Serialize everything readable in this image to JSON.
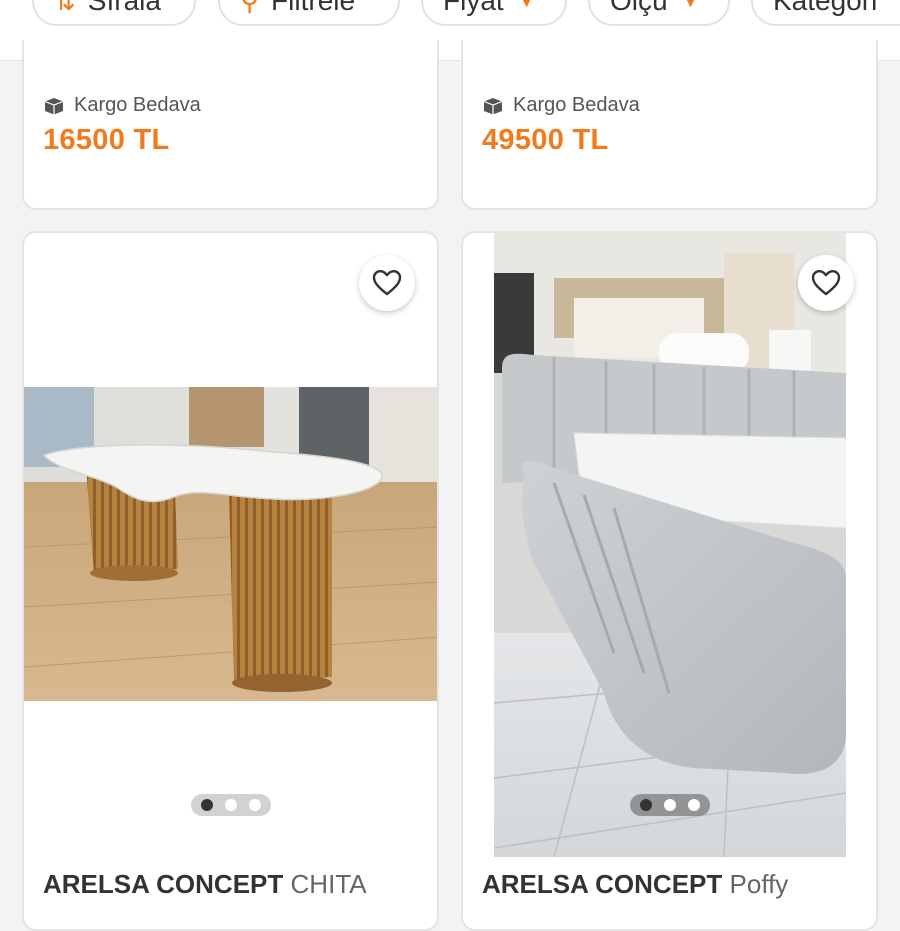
{
  "filter_bar": {
    "chips": [
      {
        "label": "Sırala",
        "icon": "sort-icon"
      },
      {
        "label": "Filtrele",
        "icon": "filter-icon"
      },
      {
        "label": "Fiyat",
        "icon": "chevron-down-icon"
      },
      {
        "label": "Ölçü",
        "icon": "chevron-down-icon"
      },
      {
        "label": "Kategori",
        "icon": ""
      }
    ]
  },
  "products_top": [
    {
      "shipping": "Kargo Bedava",
      "price": "16500 TL"
    },
    {
      "shipping": "Kargo Bedava",
      "price": "49500 TL"
    }
  ],
  "products": [
    {
      "brand": "ARELSA CONCEPT",
      "model": "CHITA",
      "image": "white-kidney-table-photo",
      "slides": 3,
      "active_slide": 1
    },
    {
      "brand": "ARELSA CONCEPT",
      "model": "Poffy",
      "image": "grey-boucle-bed-photo",
      "slides": 3,
      "active_slide": 1
    }
  ],
  "colors": {
    "accent": "#f27a1a",
    "text": "#333333",
    "muted": "#666666",
    "background": "#f3f3f3"
  }
}
